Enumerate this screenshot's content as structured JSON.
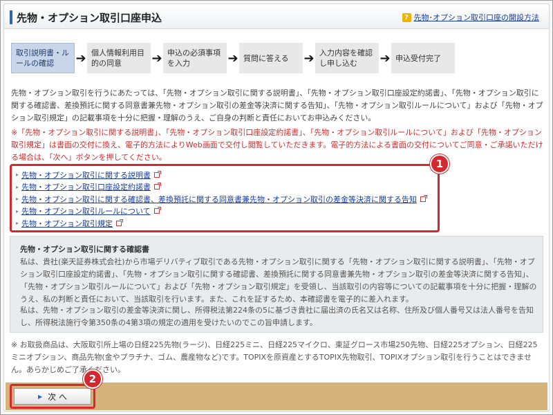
{
  "header": {
    "title": "先物・オプション取引口座申込",
    "help_icon": "?",
    "help_link": "先物･オプション取引口座の開設方法"
  },
  "steps": [
    {
      "label": "取引説明書・ルールの確認",
      "active": true
    },
    {
      "label": "個人情報利用目的の同意",
      "active": false
    },
    {
      "label": "申込の必須事項を入力",
      "active": false
    },
    {
      "label": "質問に答える",
      "active": false
    },
    {
      "label": "入力内容を確認し申し込む",
      "active": false
    },
    {
      "label": "申込受付完了",
      "active": false
    }
  ],
  "arrow_glyph": "➔",
  "description": "先物・オプション取引を行うにあたっては、「先物・オプション取引に関する説明書」、「先物・オプション取引口座設定約諾書」、「先物・オプション取引に関する確認書、差換預託に関する同意書兼先物・オプション取引の差金等決済に関する告知」、「先物・オプション取引ルールについて」および「先物・オプション取引規定」の記載事項を十分に把握・理解のうえ、ご自身の判断と責任においてお申込みください。",
  "notice": "※「先物・オプション取引に関する説明書」、「先物・オプション取引口座設定約諾書」、「先物・オプション取引ルールについて」および「先物・オプション取引規定」は書面の交付に換え、電子的方法によりWeb画面で交付し閲覧していただきます。電子的方法による書面の交付についてご同意・ご承諾いただける場合は、「次へ」ボタンを押してください。",
  "links": [
    "先物・オプション取引に関する説明書",
    "先物・オプション取引口座設定約諾書",
    "先物・オプション取引に関する確認書、差換預託に関する同意書兼先物・オプション取引の差金等決済に関する告知",
    "先物・オプション取引ルールについて",
    "先物・オプション取引規定"
  ],
  "badges": {
    "one": "1",
    "two": "2"
  },
  "confirm": {
    "title": "先物・オプション取引に関する確認書",
    "p1": "私は、貴社(楽天証券株式会社)から市場デリバティブ取引である先物・オプション取引に関する「先物・オプション取引に関する説明書」、「先物・オプション取引口座設定約諾書」、「先物・オプション取引に関する確認書、差換預託に関する同意書兼先物・オプション取引の差金等決済に関する告知」、「先物・オプション取引ルールについて」および「先物・オプション取引規定」を受領し、当該取引の内容等についての記載事項を十分に把握・理解のうえ、私の判断と責任において、当該取引を行います。また、これを証するため、本確認書を電子的に差入れます。",
    "p2": "私は、先物・オプション取引の差金等決済に関し、所得税法第224条の5に基づき貴社に届出済の氏名又は名称、住所及び個人番号又は法人番号を告知し、所得税法施行令第350条の4第3項の規定の適用を受けたいのでこの旨申請します。"
  },
  "footnote": "※ お取扱商品は、大阪取引所上場の日経225先物(ラージ)、日経225ミニ、日経225マイクロ、東証グロース市場250先物、日経225オプション、日経225ミニオプション、商品先物(金やプラチナ、ゴム、農産物など)です。TOPIXを原資産とするTOPIX先物取引、TOPIXオプション取引を行うことはできません。あらかじめご了承ください。",
  "next_button": "次 へ"
}
